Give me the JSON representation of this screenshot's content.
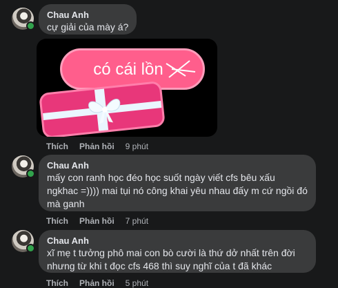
{
  "comments": [
    {
      "author": "Chau Anh",
      "text": "cự giải của mày á?",
      "sticker_text": "có cái lồn",
      "like_label": "Thích",
      "reply_label": "Phản hồi",
      "time": "9 phút"
    },
    {
      "author": "Chau Anh",
      "text": "mấy con ranh học đéo học suốt ngày viết cfs bêu xấu ngkhac =)))) mai tụi nó công khai yêu nhau đấy m cứ ngồi đó mà ganh",
      "like_label": "Thích",
      "reply_label": "Phản hồi",
      "time": "7 phút"
    },
    {
      "author": "Chau Anh",
      "text": "xĩ mẹ t tưởng phô mai con bò cười là thứ dở nhất trên đời nhưng từ khi t đọc cfs 468 thì suy nghĩ của t đã khác",
      "like_label": "Thích",
      "reply_label": "Phản hồi",
      "time": "5 phút"
    }
  ],
  "colors": {
    "background": "#18191a",
    "bubble": "#3a3b3c",
    "text": "#e4e6eb",
    "secondary_text": "#b0b3b8",
    "online": "#31a24c"
  }
}
